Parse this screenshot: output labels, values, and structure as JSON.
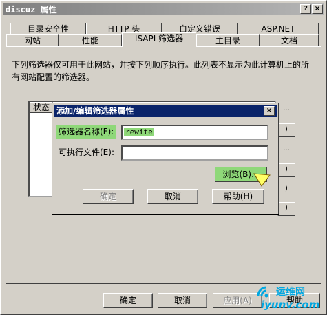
{
  "window": {
    "title": "discuz 属性",
    "help_glyph": "?",
    "close_glyph": "×"
  },
  "tabs_row1": [
    "目录安全性",
    "HTTP 头",
    "自定义错误",
    "ASP.NET"
  ],
  "tabs_row2": [
    "网站",
    "性能",
    "ISAPI 筛选器",
    "主目录",
    "文档"
  ],
  "active_tab": "ISAPI 筛选器",
  "panel": {
    "description": "下列筛选器仅可用于此网站，并按下列顺序执行。此列表不显示为此计算机上的所有网站配置的筛选器。",
    "list_header": "状态",
    "side_buttons": [
      "...",
      ")",
      "...",
      ")",
      ")",
      ")"
    ]
  },
  "dialog": {
    "title": "添加/编辑筛选器属性",
    "close_glyph": "×",
    "filter_name_label": "筛选器名称(F):",
    "filter_name_value": "rewite",
    "executable_label": "可执行文件(E):",
    "executable_value": "",
    "browse_label": "浏览(B)...",
    "ok_label": "确定",
    "cancel_label": "取消",
    "help_label": "帮助(H)"
  },
  "footer": {
    "ok_label": "确定",
    "cancel_label": "取消",
    "apply_label": "应用(A)",
    "help_label": "帮助"
  },
  "watermark": {
    "line1": "运维网",
    "line2": "iyunv.com"
  },
  "colors": {
    "highlight": "#8fd879",
    "dialog_title_bg": "#0a246a",
    "face": "#d4d0c8",
    "watermark": "#00a7e1"
  }
}
